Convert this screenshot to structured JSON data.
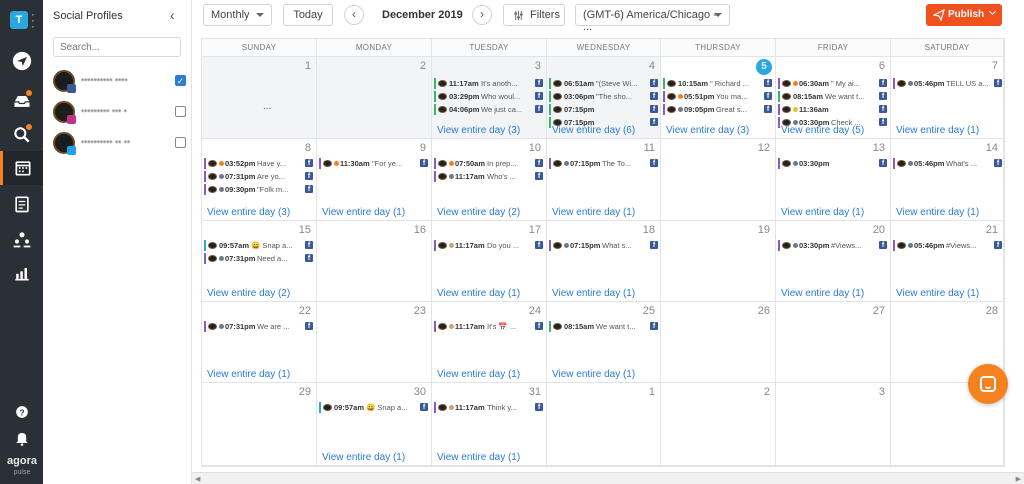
{
  "sidebar": {
    "account_initial": "T",
    "logo_main": "agora",
    "logo_sub": "pulse"
  },
  "profiles_panel": {
    "title": "Social Profiles",
    "search_placeholder": "Search...",
    "profiles": [
      {
        "name": "•••••••••• •••• ",
        "network": "facebook",
        "checked": true
      },
      {
        "name": "••••••••• ••• •",
        "network": "instagram",
        "checked": false
      },
      {
        "name": "•••••••••• •• ••",
        "network": "twitter",
        "checked": false
      }
    ]
  },
  "toolbar": {
    "view_select": "Monthly",
    "today_label": "Today",
    "prev_label": "‹",
    "next_label": "›",
    "month_label": "December 2019",
    "filters_label": "Filters",
    "timezone_select": "(GMT-6) America/Chicago - ...",
    "publish_label": "Publish"
  },
  "calendar": {
    "weekdays": [
      "SUNDAY",
      "MONDAY",
      "TUESDAY",
      "WEDNESDAY",
      "THURSDAY",
      "FRIDAY",
      "SATURDAY"
    ],
    "weeks": [
      [
        {
          "day": "1",
          "past": true,
          "ellipsis": "...",
          "posts": [],
          "view_all": ""
        },
        {
          "day": "2",
          "past": true,
          "posts": [],
          "view_all": ""
        },
        {
          "day": "3",
          "past": true,
          "posts": [
            {
              "time": "11:17am",
              "text": "It's anoth...",
              "bar": "#3cb371",
              "net": "fb"
            },
            {
              "time": "03:29pm",
              "text": "Who woul...",
              "bar": "#3cb371",
              "net": "fb"
            },
            {
              "time": "04:06pm",
              "text": "We just ca...",
              "bar": "#3cb371",
              "net": "fb"
            }
          ],
          "view_all": "View entire day (3)"
        },
        {
          "day": "4",
          "past": true,
          "posts": [
            {
              "time": "06:51am",
              "text": "\"(Steve Wi...",
              "bar": "#3cb371",
              "net": "fb"
            },
            {
              "time": "03:06pm",
              "text": "\"The sho...",
              "bar": "#3cb371",
              "net": "fb"
            },
            {
              "time": "07:15pm",
              "text": "",
              "bar": "#3cb371",
              "net": "fb"
            },
            {
              "time": "07:15pm",
              "text": "",
              "bar": "#3cb371",
              "net": "fb"
            }
          ],
          "view_all": "View entire day (6)"
        },
        {
          "day": "5",
          "today": true,
          "posts": [
            {
              "time": "10:15am",
              "text": "\" Richard ...",
              "bar": "#3cb371",
              "net": "fb"
            },
            {
              "time": "05:51pm",
              "text": "You ma...",
              "bar": "#8a5cc7",
              "net": "fb",
              "status": "#f5821f"
            },
            {
              "time": "09:05pm",
              "text": "Great s...",
              "bar": "#8a5cc7",
              "net": "fb",
              "status": "#6c7a89"
            }
          ],
          "view_all": "View entire day (3)"
        },
        {
          "day": "6",
          "posts": [
            {
              "time": "06:30am",
              "text": "\" My ai...",
              "bar": "#8a5cc7",
              "net": "fb",
              "status": "#f5821f"
            },
            {
              "time": "08:15am",
              "text": "We want t...",
              "bar": "#3cb371",
              "net": "fb"
            },
            {
              "time": "11:36am",
              "text": "",
              "bar": "#8a5cc7",
              "net": "fb",
              "status": "#e6c229"
            },
            {
              "time": "03:30pm",
              "text": "Check ...",
              "bar": "#8a5cc7",
              "net": "fb",
              "status": "#6c7a89"
            }
          ],
          "view_all": "View entire day (5)"
        },
        {
          "day": "7",
          "posts": [
            {
              "time": "05:46pm",
              "text": "TELL US a...",
              "bar": "#8a5cc7",
              "net": "fb",
              "status": "#6c7a89"
            }
          ],
          "view_all": "View entire day (1)"
        }
      ],
      [
        {
          "day": "8",
          "posts": [
            {
              "time": "03:52pm",
              "text": "Have y...",
              "bar": "#8a5cc7",
              "net": "fb",
              "status": "#f5821f"
            },
            {
              "time": "07:31pm",
              "text": "Are yo...",
              "bar": "#8a5cc7",
              "net": "fb",
              "status": "#6c7a89"
            },
            {
              "time": "09:30pm",
              "text": "\"Folk m...",
              "bar": "#8a5cc7",
              "net": "fb",
              "status": "#6c7a89"
            }
          ],
          "view_all": "View entire day (3)"
        },
        {
          "day": "9",
          "posts": [
            {
              "time": "11:30am",
              "text": "\"For ye...",
              "bar": "#8a5cc7",
              "net": "fb",
              "status": "#f5821f"
            }
          ],
          "view_all": "View entire day (1)"
        },
        {
          "day": "10",
          "posts": [
            {
              "time": "07:50am",
              "text": "In prep...",
              "bar": "#8a5cc7",
              "net": "fb",
              "status": "#f5821f"
            },
            {
              "time": "11:17am",
              "text": "Who's ...",
              "bar": "#8a5cc7",
              "net": "fb",
              "status": "#6c7a89"
            }
          ],
          "view_all": "View entire day (2)"
        },
        {
          "day": "11",
          "posts": [
            {
              "time": "07:15pm",
              "text": "The To...",
              "bar": "#8a5cc7",
              "net": "fb",
              "status": "#6c7a89"
            }
          ],
          "view_all": "View entire day (1)"
        },
        {
          "day": "12",
          "posts": [],
          "view_all": ""
        },
        {
          "day": "13",
          "posts": [
            {
              "time": "03:30pm",
              "text": "",
              "bar": "#8a5cc7",
              "net": "fb",
              "status": "#6c7a89"
            }
          ],
          "view_all": "View entire day (1)"
        },
        {
          "day": "14",
          "posts": [
            {
              "time": "05:46pm",
              "text": "What's ...",
              "bar": "#8a5cc7",
              "net": "fb",
              "status": "#6c7a89"
            }
          ],
          "view_all": "View entire day (1)"
        }
      ],
      [
        {
          "day": "15",
          "posts": [
            {
              "time": "09:57am",
              "text": "😀 Snap a...",
              "bar": "#29a8e0",
              "net": "fb"
            },
            {
              "time": "07:31pm",
              "text": "Need a...",
              "bar": "#8a5cc7",
              "net": "fb",
              "status": "#6c7a89"
            }
          ],
          "view_all": "View entire day (2)"
        },
        {
          "day": "16",
          "posts": [],
          "view_all": ""
        },
        {
          "day": "17",
          "posts": [
            {
              "time": "11:17am",
              "text": "Do you ...",
              "bar": "#8a5cc7",
              "net": "fb",
              "status": "#c8a27a"
            }
          ],
          "view_all": "View entire day (1)"
        },
        {
          "day": "18",
          "posts": [
            {
              "time": "07:15pm",
              "text": "What s...",
              "bar": "#8a5cc7",
              "net": "fb",
              "status": "#6c7a89"
            }
          ],
          "view_all": "View entire day (1)"
        },
        {
          "day": "19",
          "posts": [],
          "view_all": ""
        },
        {
          "day": "20",
          "posts": [
            {
              "time": "03:30pm",
              "text": "#Views...",
              "bar": "#8a5cc7",
              "net": "fb",
              "status": "#6c7a89"
            }
          ],
          "view_all": "View entire day (1)"
        },
        {
          "day": "21",
          "posts": [
            {
              "time": "05:46pm",
              "text": "#Views...",
              "bar": "#8a5cc7",
              "net": "fb",
              "status": "#6c7a89"
            }
          ],
          "view_all": "View entire day (1)"
        }
      ],
      [
        {
          "day": "22",
          "posts": [
            {
              "time": "07:31pm",
              "text": "We are ...",
              "bar": "#8a5cc7",
              "net": "fb",
              "status": "#6c7a89"
            }
          ],
          "view_all": "View entire day (1)"
        },
        {
          "day": "23",
          "posts": [],
          "view_all": ""
        },
        {
          "day": "24",
          "posts": [
            {
              "time": "11:17am",
              "text": "It's 📅 ...",
              "bar": "#8a5cc7",
              "net": "fb",
              "status": "#c8a27a"
            }
          ],
          "view_all": "View entire day (1)"
        },
        {
          "day": "25",
          "posts": [
            {
              "time": "08:15am",
              "text": "We want t...",
              "bar": "#3cb371",
              "net": "fb"
            }
          ],
          "view_all": "View entire day (1)"
        },
        {
          "day": "26",
          "posts": [],
          "view_all": ""
        },
        {
          "day": "27",
          "posts": [],
          "view_all": ""
        },
        {
          "day": "28",
          "posts": [],
          "view_all": ""
        }
      ],
      [
        {
          "day": "29",
          "posts": [],
          "view_all": ""
        },
        {
          "day": "30",
          "posts": [
            {
              "time": "09:57am",
              "text": "😀 Snap a...",
              "bar": "#29a8e0",
              "net": "fb"
            }
          ],
          "view_all": "View entire day (1)"
        },
        {
          "day": "31",
          "posts": [
            {
              "time": "11:17am",
              "text": "Think y...",
              "bar": "#8a5cc7",
              "net": "fb",
              "status": "#c8a27a"
            }
          ],
          "view_all": "View entire day (1)"
        },
        {
          "day": "1",
          "posts": [],
          "view_all": ""
        },
        {
          "day": "2",
          "posts": [],
          "view_all": ""
        },
        {
          "day": "3",
          "posts": [],
          "view_all": ""
        },
        {
          "day": "",
          "posts": [],
          "view_all": ""
        }
      ]
    ]
  },
  "colors": {
    "accent": "#f0511e",
    "link": "#2a7cd4",
    "today": "#29a8e0",
    "rail": "#2b3036",
    "chat": "#f5821f"
  }
}
